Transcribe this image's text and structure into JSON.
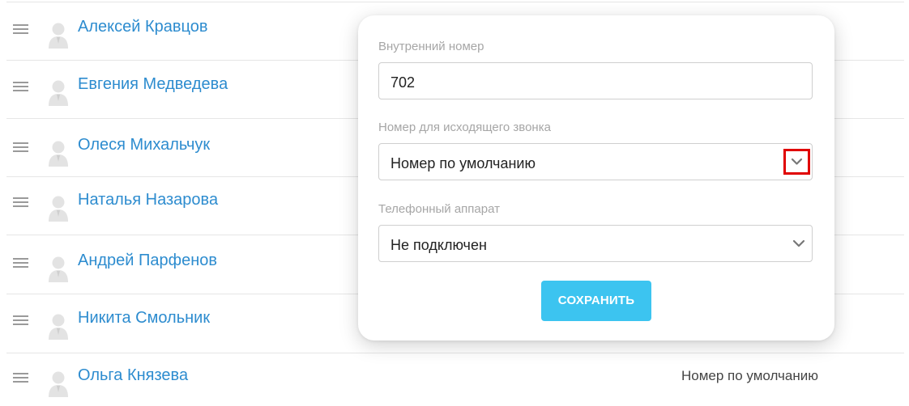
{
  "users": [
    {
      "name": "Алексей Кравцов",
      "value": ""
    },
    {
      "name": "Евгения Медведева",
      "value": ""
    },
    {
      "name": "Олеся Михальчук",
      "value": ""
    },
    {
      "name": "Наталья Назарова",
      "value": ""
    },
    {
      "name": "Андрей Парфенов",
      "value": ""
    },
    {
      "name": "Никита Смольник",
      "value": ""
    },
    {
      "name": "Ольга Князева",
      "value": "Номер по умолчанию"
    }
  ],
  "modal": {
    "extension": {
      "label": "Внутренний номер",
      "value": "702"
    },
    "outgoing_number": {
      "label": "Номер для исходящего звонка",
      "selected": "Номер по умолчанию"
    },
    "phone_device": {
      "label": "Телефонный аппарат",
      "selected": "Не подключен"
    },
    "save_label": "СОХРАНИТЬ"
  },
  "colors": {
    "link": "#2d8ccf",
    "accent_button": "#3cc4f0",
    "highlight": "#e00000"
  },
  "icons": {
    "drag": "drag-handle-icon",
    "avatar": "user-avatar-icon",
    "dropdown": "chevron-down-icon"
  }
}
